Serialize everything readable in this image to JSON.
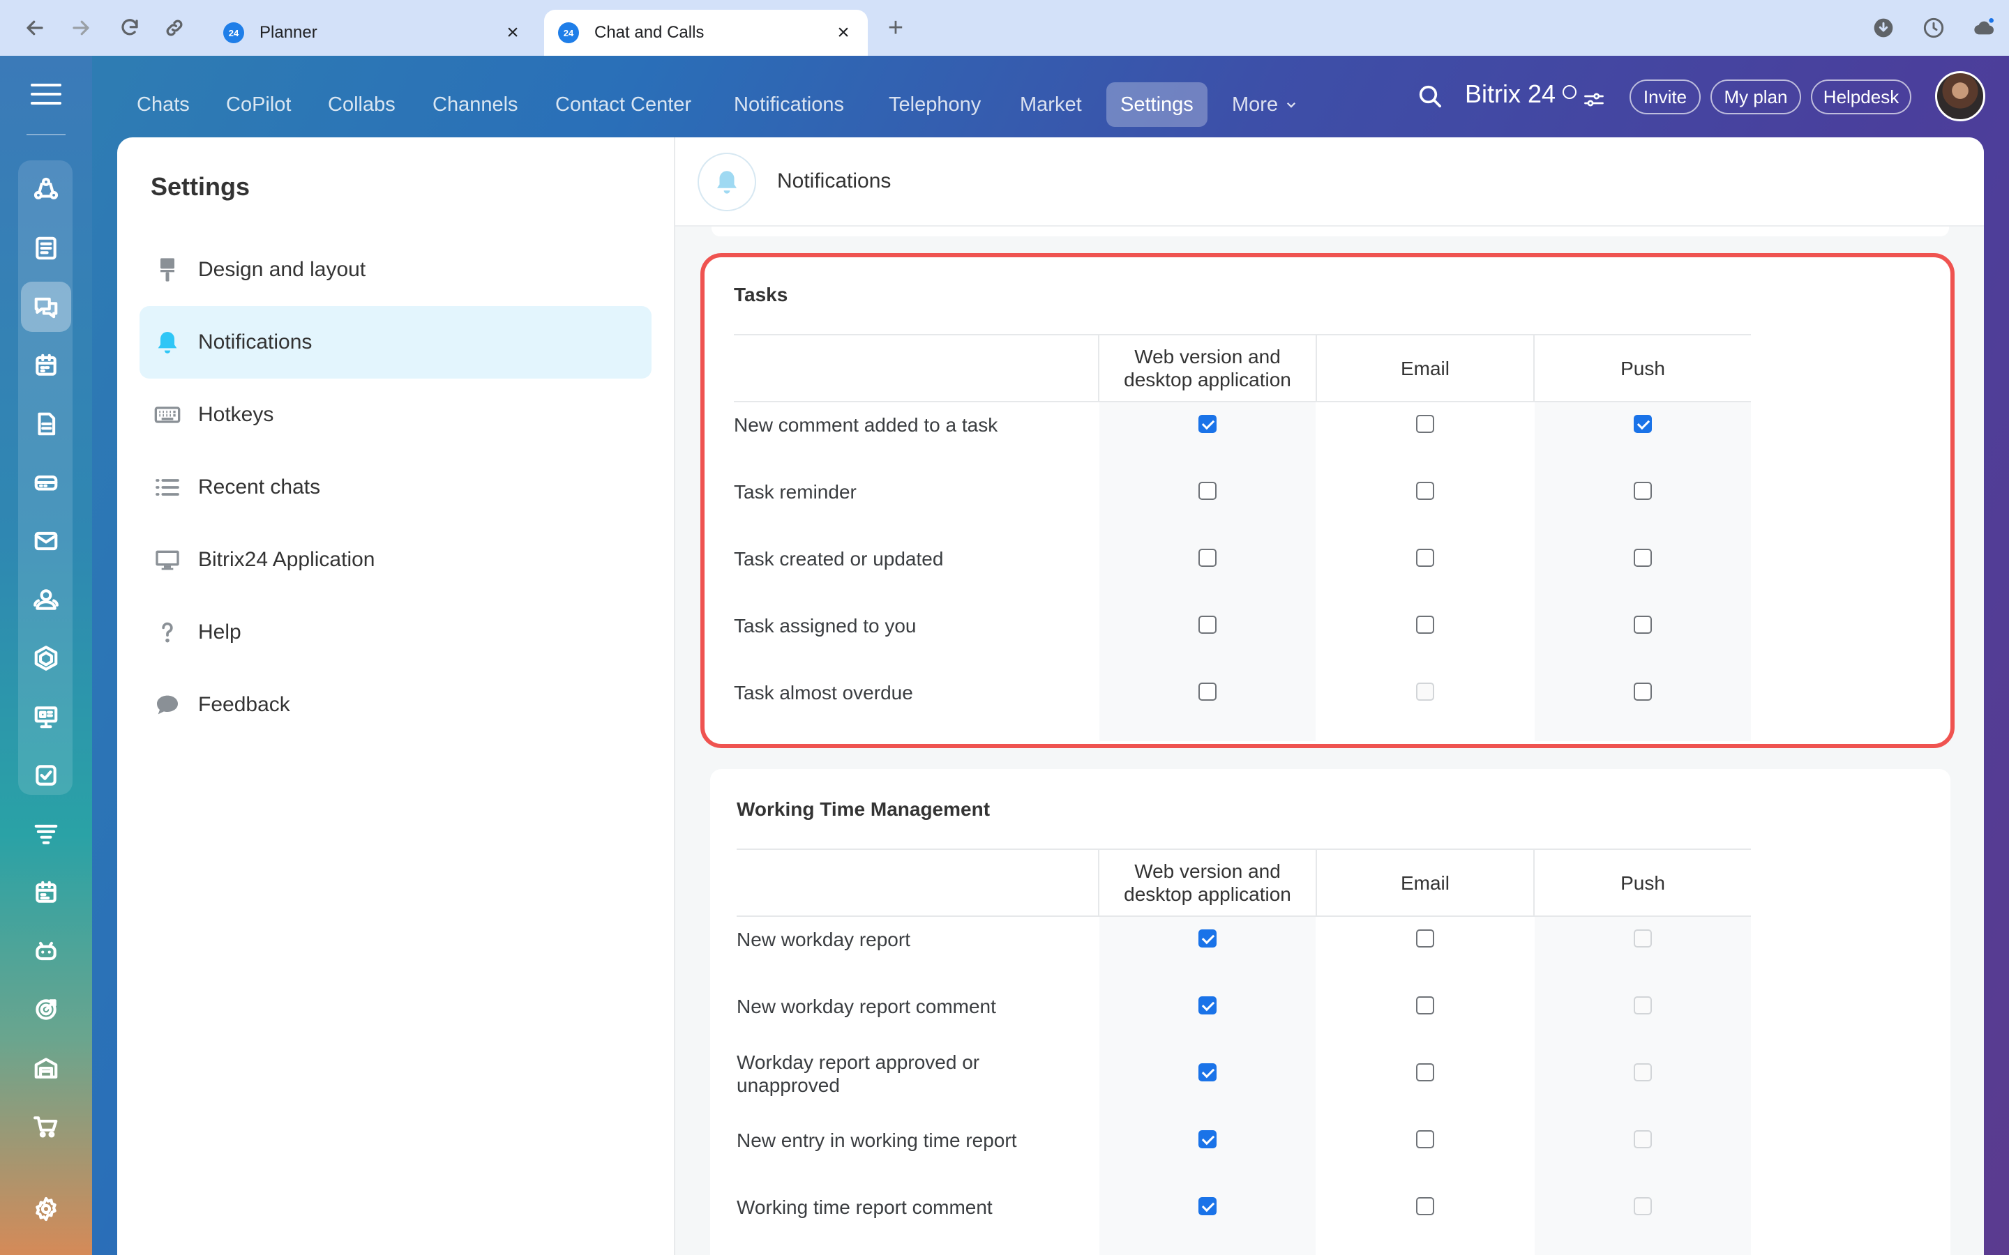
{
  "browser": {
    "tabs": [
      {
        "title": "Planner",
        "favicon": "24"
      },
      {
        "title": "Chat and Calls",
        "favicon": "24"
      }
    ],
    "close_glyph": "×",
    "new_tab_glyph": "+"
  },
  "topnav": {
    "items": [
      "Chats",
      "CoPilot",
      "Collabs",
      "Channels",
      "Contact Center",
      "Notifications",
      "Telephony",
      "Market",
      "Settings"
    ],
    "more_label": "More",
    "brand": "Bitrix 24",
    "buttons": [
      "Invite",
      "My plan",
      "Helpdesk"
    ]
  },
  "settings": {
    "title": "Settings",
    "menu": [
      "Design and layout",
      "Notifications",
      "Hotkeys",
      "Recent chats",
      "Bitrix24 Application",
      "Help",
      "Feedback"
    ],
    "page_title": "Notifications"
  },
  "columns": [
    "Web version and desktop application",
    "Email",
    "Push"
  ],
  "sections": [
    {
      "title": "Tasks",
      "rows": [
        {
          "label": "New comment added to a task",
          "web": "checked",
          "email": "unchecked",
          "push": "checked"
        },
        {
          "label": "Task reminder",
          "web": "unchecked",
          "email": "unchecked",
          "push": "unchecked"
        },
        {
          "label": "Task created or updated",
          "web": "unchecked",
          "email": "unchecked",
          "push": "unchecked"
        },
        {
          "label": "Task assigned to you",
          "web": "unchecked",
          "email": "unchecked",
          "push": "unchecked"
        },
        {
          "label": "Task almost overdue",
          "web": "unchecked",
          "email": "disabled",
          "push": "unchecked"
        }
      ]
    },
    {
      "title": "Working Time Management",
      "rows": [
        {
          "label": "New workday report",
          "web": "checked",
          "email": "unchecked",
          "push": "disabled"
        },
        {
          "label": "New workday report comment",
          "web": "checked",
          "email": "unchecked",
          "push": "disabled"
        },
        {
          "label": "Workday report approved or unapproved",
          "web": "checked",
          "email": "unchecked",
          "push": "disabled"
        },
        {
          "label": "New entry in working time report",
          "web": "checked",
          "email": "unchecked",
          "push": "disabled"
        },
        {
          "label": "Working time report comment",
          "web": "checked",
          "email": "unchecked",
          "push": "disabled"
        }
      ]
    }
  ],
  "colors": {
    "accent": "#1a73e8",
    "highlight_border": "#ef5350",
    "active_menu_bg": "#e3f5fd",
    "bell": "#2fc6f6"
  }
}
